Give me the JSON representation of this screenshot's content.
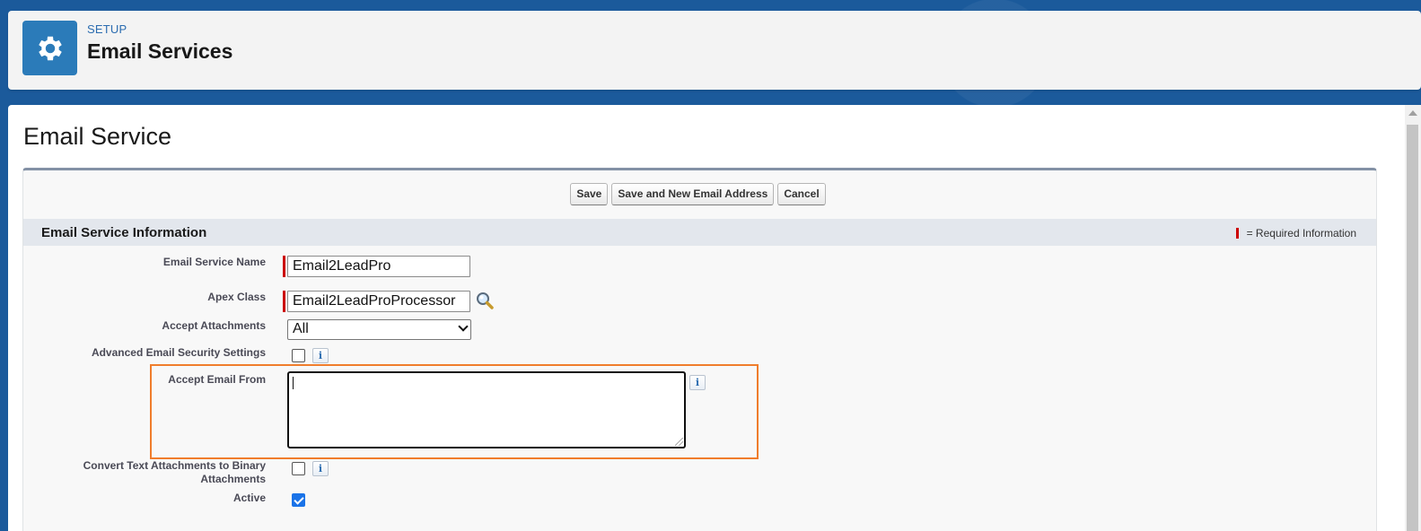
{
  "header": {
    "eyebrow": "SETUP",
    "title": "Email Services",
    "icon": "gear-icon"
  },
  "page": {
    "title": "Email Service"
  },
  "toolbar": {
    "save_label": "Save",
    "save_new_label": "Save and New Email Address",
    "cancel_label": "Cancel"
  },
  "section": {
    "title": "Email Service Information",
    "required_legend": "= Required Information"
  },
  "fields": {
    "service_name": {
      "label": "Email Service Name",
      "value": "Email2LeadPro"
    },
    "apex_class": {
      "label": "Apex Class",
      "value": "Email2LeadProProcessor",
      "lookup_icon": "magnifier-icon"
    },
    "accept_attachments": {
      "label": "Accept Attachments",
      "value": "All"
    },
    "advanced_security": {
      "label": "Advanced Email Security Settings",
      "checked": false,
      "info_icon": "info-icon"
    },
    "accept_email_from": {
      "label": "Accept Email From",
      "value": "",
      "info_icon": "info-icon"
    },
    "convert_text": {
      "label_line1": "Convert Text Attachments to Binary",
      "label_line2": "Attachments",
      "checked": false,
      "info_icon": "info-icon"
    },
    "active": {
      "label": "Active",
      "checked": true
    }
  },
  "colors": {
    "highlight": "#f07d2c",
    "required": "#cc0000",
    "checkbox_checked": "#1a73e8"
  }
}
